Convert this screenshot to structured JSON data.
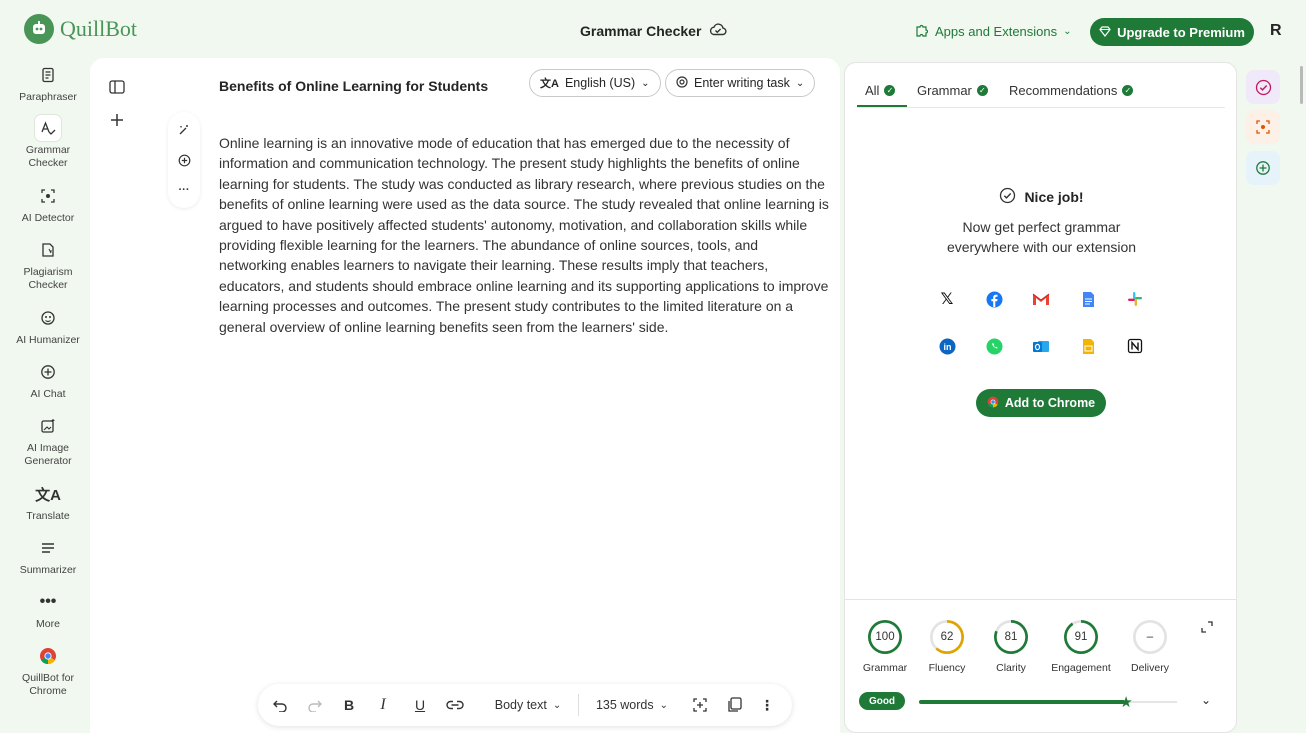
{
  "app": {
    "name": "QuillBot",
    "page_title": "Grammar Checker",
    "apps_extensions_label": "Apps and Extensions",
    "upgrade_label": "Upgrade to Premium",
    "user_initial": "R"
  },
  "sidebar": {
    "items": [
      {
        "label": "Paraphraser",
        "icon": "paraphraser-icon"
      },
      {
        "label": "Grammar Checker",
        "icon": "grammar-icon"
      },
      {
        "label": "AI Detector",
        "icon": "ai-detector-icon"
      },
      {
        "label": "Plagiarism Checker",
        "icon": "plagiarism-icon"
      },
      {
        "label": "AI Humanizer",
        "icon": "humanizer-icon"
      },
      {
        "label": "AI Chat",
        "icon": "ai-chat-icon"
      },
      {
        "label": "AI Image Generator",
        "icon": "image-generator-icon"
      },
      {
        "label": "Translate",
        "icon": "translate-icon"
      },
      {
        "label": "Summarizer",
        "icon": "summarizer-icon"
      },
      {
        "label": "More",
        "icon": "more-icon"
      },
      {
        "label": "QuillBot for Chrome",
        "icon": "chrome-icon"
      }
    ]
  },
  "editor": {
    "doc_title": "Benefits of Online Learning for Students",
    "language_label": "English (US)",
    "writing_task_label": "Enter writing task",
    "body": "Online learning is an innovative mode of education that has emerged due to the necessity of information and communication technology. The present study highlights the benefits of online learning for students. The study was conducted as library research, where previous studies on the benefits of online learning were used as the data source. The study revealed that online learning is argued to have positively affected students' autonomy, motivation, and collaboration skills while providing flexible learning for the learners. The abundance of online sources, tools, and networking enables learners to navigate their learning. These results imply that teachers, educators, and students should embrace online learning and its supporting applications to improve learning processes and outcomes. The present study contributes to the limited literature on a general overview of online learning benefits seen from the learners' side."
  },
  "toolbar": {
    "style_label": "Body text",
    "word_count_label": "135 words"
  },
  "panel": {
    "tabs": [
      {
        "label": "All"
      },
      {
        "label": "Grammar"
      },
      {
        "label": "Recommendations"
      }
    ],
    "nice_job": "Nice job!",
    "promo_line1": "Now get perfect grammar",
    "promo_line2": "everywhere with our extension",
    "add_chrome_label": "Add to Chrome",
    "social_icons": [
      "x-icon",
      "facebook-icon",
      "gmail-icon",
      "google-docs-icon",
      "slack-icon",
      "linkedin-icon",
      "whatsapp-icon",
      "outlook-icon",
      "google-slides-icon",
      "notion-icon"
    ]
  },
  "scores": {
    "items": [
      {
        "label": "Grammar",
        "value": "100",
        "fraction": 1.0,
        "color": "#1f7a38"
      },
      {
        "label": "Fluency",
        "value": "62",
        "fraction": 0.62,
        "color": "#e0a400"
      },
      {
        "label": "Clarity",
        "value": "81",
        "fraction": 0.81,
        "color": "#1f7a38"
      },
      {
        "label": "Engagement",
        "value": "91",
        "fraction": 0.91,
        "color": "#1f7a38"
      },
      {
        "label": "Delivery",
        "value": "–",
        "fraction": 0,
        "color": "#cccccc"
      }
    ],
    "quality_label": "Good",
    "quality_fraction": 0.8
  },
  "colors": {
    "brand_green": "#1f7a38",
    "logo_green": "#499557",
    "page_bg": "#f1f8ef"
  }
}
